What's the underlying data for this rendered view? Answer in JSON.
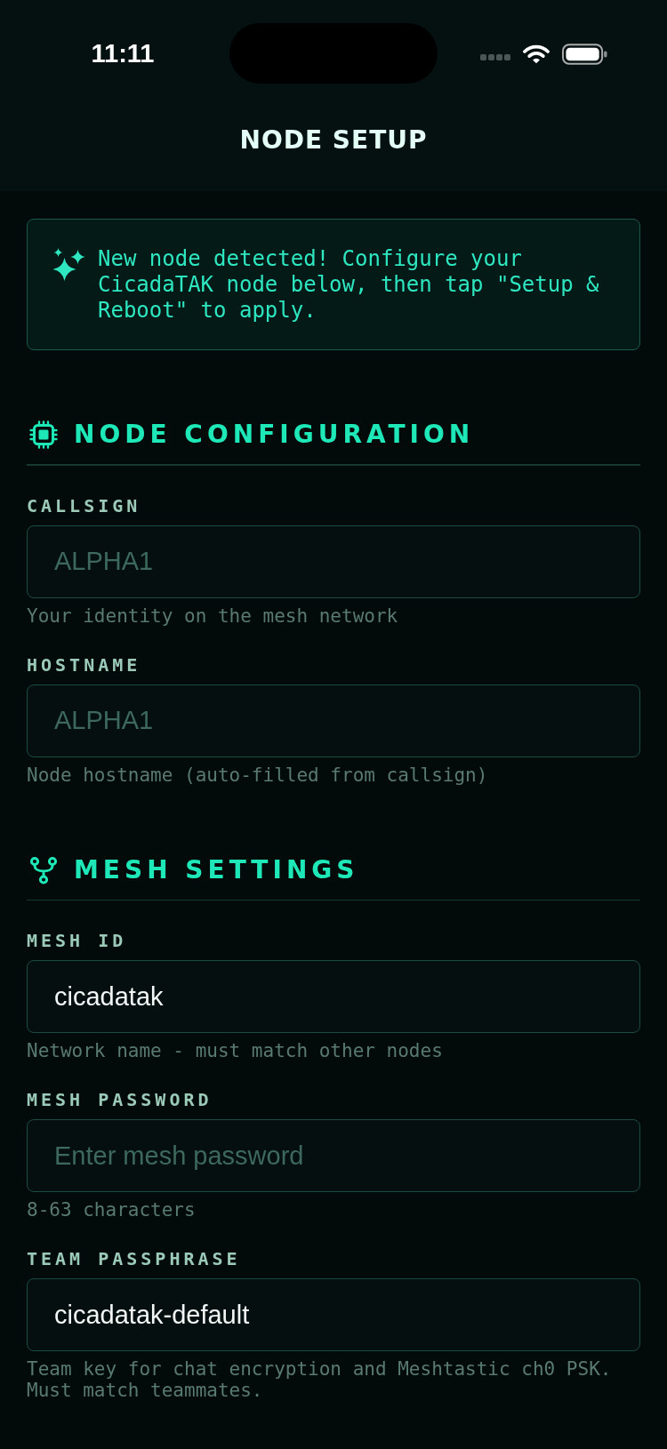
{
  "status_bar": {
    "time": "11:11"
  },
  "header": {
    "title": "NODE SETUP"
  },
  "banner": {
    "text": "New node detected! Configure your CicadaTAK node below, then tap \"Setup & Reboot\" to apply."
  },
  "sections": [
    {
      "kind": "node",
      "title": "NODE CONFIGURATION",
      "fields": [
        {
          "label": "CALLSIGN",
          "placeholder": "ALPHA1",
          "hint": "Your identity on the mesh network"
        },
        {
          "label": "HOSTNAME",
          "placeholder": "ALPHA1",
          "hint": "Node hostname (auto-filled from callsign)"
        }
      ]
    },
    {
      "kind": "mesh",
      "title": "MESH SETTINGS",
      "fields": [
        {
          "label": "MESH ID",
          "value": "cicadatak",
          "hint": "Network name - must match other nodes"
        },
        {
          "label": "MESH PASSWORD",
          "placeholder": "Enter mesh password",
          "hint": "8-63 characters"
        },
        {
          "label": "TEAM PASSPHRASE",
          "value": "cicadatak-default",
          "hint": "Team key for chat encryption and Meshtastic ch0 PSK. Must match teammates."
        }
      ]
    }
  ]
}
